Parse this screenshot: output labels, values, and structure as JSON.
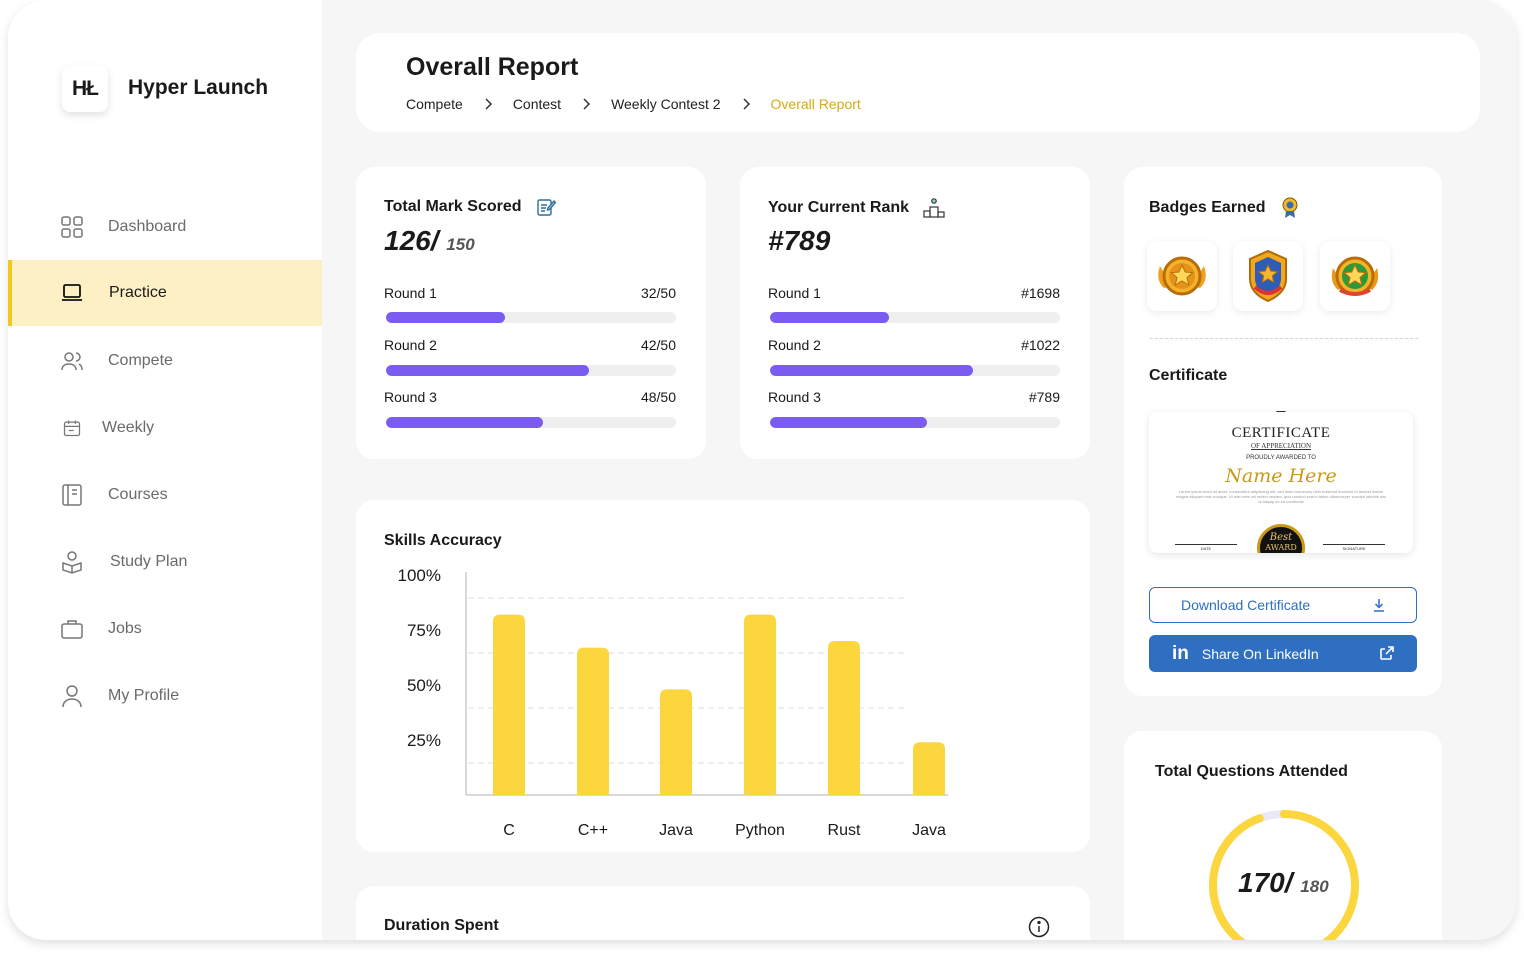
{
  "app": {
    "logo_text": "HŁ",
    "name": "Hyper Launch"
  },
  "sidebar": {
    "items": [
      {
        "label": "Dashboard",
        "icon": "grid-icon"
      },
      {
        "label": "Practice",
        "icon": "laptop-icon",
        "active": true
      },
      {
        "label": "Compete",
        "icon": "users-icon"
      },
      {
        "label": "Weekly",
        "icon": "calendar-icon"
      },
      {
        "label": "Courses",
        "icon": "book-icon"
      },
      {
        "label": "Study Plan",
        "icon": "study-icon"
      },
      {
        "label": "Jobs",
        "icon": "briefcase-icon"
      },
      {
        "label": "My Profile",
        "icon": "user-icon"
      }
    ]
  },
  "header": {
    "title": "Overall Report",
    "breadcrumb": [
      "Compete",
      "Contest",
      "Weekly Contest 2",
      "Overall Report"
    ]
  },
  "marks": {
    "title": "Total Mark Scored",
    "score": "126/",
    "total": "150",
    "rounds": [
      {
        "label": "Round 1",
        "value": "32/50",
        "progress": 0.41
      },
      {
        "label": "Round 2",
        "value": "42/50",
        "progress": 0.7
      },
      {
        "label": "Round 3",
        "value": "48/50",
        "progress": 0.54
      }
    ]
  },
  "rank": {
    "title": "Your Current Rank",
    "value": "#789",
    "rounds": [
      {
        "label": "Round 1",
        "value": "#1698",
        "progress": 0.41
      },
      {
        "label": "Round 2",
        "value": "#1022",
        "progress": 0.7
      },
      {
        "label": "Round 3",
        "value": "#789",
        "progress": 0.54
      }
    ]
  },
  "badges": {
    "title": "Badges Earned",
    "items": [
      {
        "icon": "gold-star-badge-icon"
      },
      {
        "icon": "blue-shield-badge-icon"
      },
      {
        "icon": "green-star-badge-icon"
      }
    ]
  },
  "certificate": {
    "title": "Certificate",
    "heading": "CERTIFICATE",
    "subheading": "OF APPRECIATION",
    "awarded": "PROUDLY AWARDED TO",
    "name": "Name Here",
    "body": "Lorem ipsum dolor sit amet, consectetur adipiscing elit, sed diam nonummy nibh euismod tincidunt ut laoreet dolore magna aliquam erat volutpat. Ut wisi enim ad minim veniam, quis nostrud exerci tation ullamcorper suscipit lobortis nisl ut aliquip ex ea commodo",
    "date_label": "DATE",
    "signature_label": "SIGNATURE",
    "seal_top": "Best",
    "seal_bottom": "AWARD",
    "download_label": "Download Certificate",
    "share_label": "Share On LinkedIn",
    "linkedin_text": "in"
  },
  "skills": {
    "title": "Skills Accuracy"
  },
  "chart_data": {
    "type": "bar",
    "title": "Skills Accuracy",
    "categories": [
      "C",
      "C++",
      "Java",
      "Python",
      "Rust",
      "Java"
    ],
    "values": [
      82,
      67,
      48,
      82,
      70,
      24
    ],
    "yticks": [
      "100%",
      "75%",
      "50%",
      "25%"
    ],
    "ylim": [
      0,
      100
    ],
    "grid": true,
    "color": "#fcd63e"
  },
  "duration": {
    "title": "Duration Spent"
  },
  "questions": {
    "title": "Total Questions Attended",
    "value": "170/",
    "total": "180",
    "progress": 0.944
  },
  "colors": {
    "accent": "#f2c623",
    "progress": "#7c5cf0",
    "link": "#2f6fc1",
    "active_bg": "#fdf0c4",
    "breadcrumb_current": "#d8a914"
  }
}
